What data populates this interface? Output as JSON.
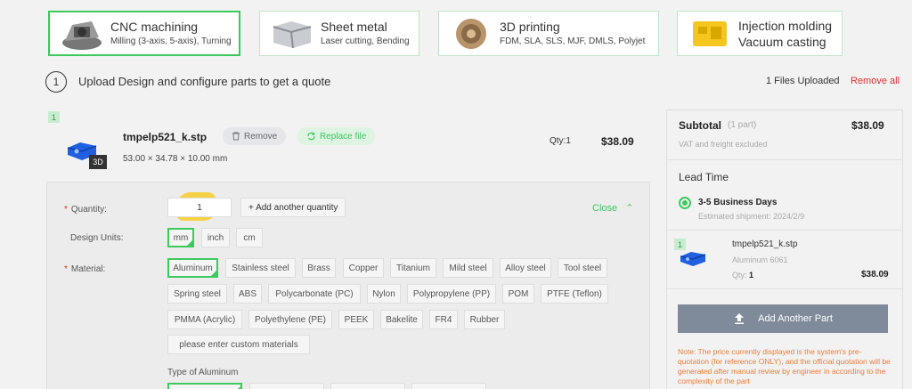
{
  "services": [
    {
      "title": "CNC machining",
      "subtitle": "Milling (3-axis, 5-axis), Turning",
      "icon": "cnc-part-icon",
      "active": true
    },
    {
      "title": "Sheet metal",
      "subtitle": "Laser cutting, Bending",
      "icon": "sheet-metal-icon",
      "active": false
    },
    {
      "title": "3D printing",
      "subtitle": "FDM, SLA, SLS, MJF, DMLS, Polyjet",
      "icon": "3d-print-icon",
      "active": false
    },
    {
      "title": "Injection molding",
      "title2": "Vacuum casting",
      "icon": "mold-icon",
      "active": false
    }
  ],
  "step": {
    "number": "1",
    "text": "Upload Design and configure parts to get a quote"
  },
  "files_uploaded": "1 Files Uploaded",
  "remove_all": "Remove all",
  "part": {
    "index": "1",
    "filename": "tmpelp521_k.stp",
    "dimensions": "53.00 × 34.78 × 10.00 mm",
    "badge_3d": "3D",
    "remove_label": "Remove",
    "replace_label": "Replace file",
    "qty_label": "Qty:1",
    "price": "$38.09"
  },
  "config": {
    "quantity_label": "Quantity:",
    "quantity_value": "1",
    "add_quantity": "+ Add another quantity",
    "close_label": "Close",
    "units_label": "Design Units:",
    "units": [
      "mm",
      "inch",
      "cm"
    ],
    "units_selected": "mm",
    "material_label": "Material:",
    "materials": [
      "Aluminum",
      "Stainless steel",
      "Brass",
      "Copper",
      "Titanium",
      "Mild steel",
      "Alloy steel",
      "Tool steel",
      "Spring steel",
      "ABS",
      "Polycarbonate (PC)",
      "Nylon",
      "Polypropylene (PP)",
      "POM",
      "PTFE (Teflon)",
      "PMMA (Acrylic)",
      "Polyethylene (PE)",
      "PEEK",
      "Bakelite",
      "FR4",
      "Rubber",
      "please enter custom materials"
    ],
    "material_selected": "Aluminum",
    "type_label": "Type of Aluminum"
  },
  "summary": {
    "subtotal_label": "Subtotal",
    "parts": "(1 part)",
    "subtotal": "$38.09",
    "vat_note": "VAT and freight excluded",
    "lead_time_title": "Lead Time",
    "lead_option": "3-5 Business Days",
    "estimated_shipment": "Estimated shipment: 2024/2/9",
    "item_index": "1",
    "item_name": "tmpelp521_k.stp",
    "item_material": "Aluminum 6061",
    "item_qty_label": "Qty:",
    "item_qty": "1",
    "item_price": "$38.09",
    "add_part_label": "Add Another Part",
    "price_note": "Note: The price currently displayed is the system's pre-quotation (for reference ONLY), and the official quotation will be generated after manual review by engineer in according to the complexity of the part"
  },
  "colors": {
    "accent": "#3ec85d",
    "danger": "#e0312d",
    "note": "#f07b3a",
    "button": "#7f8b9b"
  }
}
